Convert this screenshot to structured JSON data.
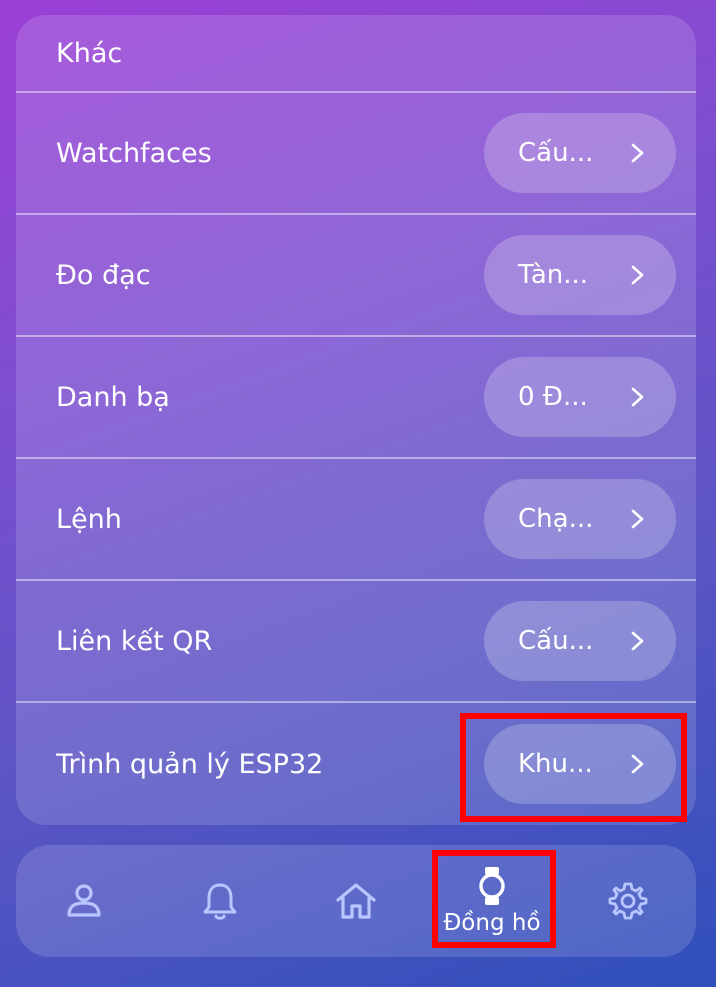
{
  "section": {
    "title": "Khác"
  },
  "rows": [
    {
      "label": "Watchfaces",
      "value": "Cấu..."
    },
    {
      "label": "Đo đạc",
      "value": "Tàn..."
    },
    {
      "label": "Danh bạ",
      "value": "0 Đ..."
    },
    {
      "label": "Lệnh",
      "value": "Chạ..."
    },
    {
      "label": "Liên kết QR",
      "value": "Cấu..."
    },
    {
      "label": "Trình quản lý ESP32",
      "value": "Khu..."
    }
  ],
  "nav": {
    "items": [
      {
        "icon": "user-icon",
        "label": ""
      },
      {
        "icon": "bell-icon",
        "label": ""
      },
      {
        "icon": "home-icon",
        "label": ""
      },
      {
        "icon": "watch-icon",
        "label": "Đồng hồ",
        "active": true
      },
      {
        "icon": "gear-icon",
        "label": ""
      }
    ]
  },
  "colors": {
    "highlight": "#ff0000",
    "icon_inactive": "#b9c6ff",
    "icon_active": "#ffffff"
  }
}
